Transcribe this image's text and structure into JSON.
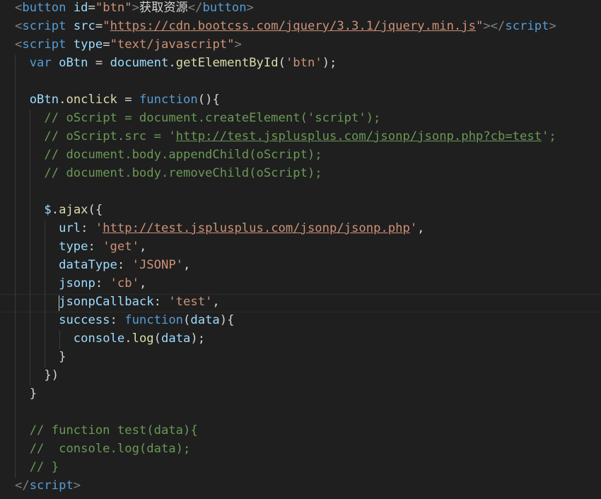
{
  "editor": {
    "language": "html",
    "theme_colors": {
      "background": "#1f1f1f",
      "tag": "#569cd6",
      "attribute": "#9cdcfe",
      "string": "#ce9178",
      "comment": "#6a9955",
      "function": "#dcdcaa",
      "text": "#d4d4d4"
    },
    "cursor_line": 17,
    "lines": [
      [
        [
          "tag-punc",
          "<"
        ],
        [
          "tag",
          "button"
        ],
        [
          "text",
          " "
        ],
        [
          "attr",
          "id"
        ],
        [
          "punc",
          "="
        ],
        [
          "str",
          "\"btn\""
        ],
        [
          "tag-punc",
          ">"
        ],
        [
          "text",
          "获取资源"
        ],
        [
          "tag-punc",
          "</"
        ],
        [
          "tag",
          "button"
        ],
        [
          "tag-punc",
          ">"
        ]
      ],
      [
        [
          "tag-punc",
          "<"
        ],
        [
          "tag",
          "script"
        ],
        [
          "text",
          " "
        ],
        [
          "attr",
          "src"
        ],
        [
          "punc",
          "="
        ],
        [
          "str",
          "\""
        ],
        [
          "url",
          "https://cdn.bootcss.com/jquery/3.3.1/jquery.min.js"
        ],
        [
          "str",
          "\""
        ],
        [
          "tag-punc",
          "></"
        ],
        [
          "tag",
          "script"
        ],
        [
          "tag-punc",
          ">"
        ]
      ],
      [
        [
          "tag-punc",
          "<"
        ],
        [
          "tag",
          "script"
        ],
        [
          "text",
          " "
        ],
        [
          "attr",
          "type"
        ],
        [
          "punc",
          "="
        ],
        [
          "str",
          "\"text/javascript\""
        ],
        [
          "tag-punc",
          ">"
        ]
      ],
      [
        [
          "text",
          "  "
        ],
        [
          "kw",
          "var"
        ],
        [
          "text",
          " "
        ],
        [
          "var",
          "oBtn"
        ],
        [
          "punc",
          " = "
        ],
        [
          "var",
          "document"
        ],
        [
          "punc",
          "."
        ],
        [
          "fn",
          "getElementById"
        ],
        [
          "punc",
          "("
        ],
        [
          "str",
          "'btn'"
        ],
        [
          "punc",
          ");"
        ]
      ],
      [],
      [
        [
          "text",
          "  "
        ],
        [
          "var",
          "oBtn"
        ],
        [
          "punc",
          "."
        ],
        [
          "fn",
          "onclick"
        ],
        [
          "punc",
          " = "
        ],
        [
          "kw",
          "function"
        ],
        [
          "punc",
          "(){"
        ]
      ],
      [
        [
          "text",
          "    "
        ],
        [
          "cm",
          "// oScript = document.createElement('script');"
        ]
      ],
      [
        [
          "text",
          "    "
        ],
        [
          "cm",
          "// oScript.src = '"
        ],
        [
          "cm-url",
          "http://test.jsplusplus.com/jsonp/jsonp.php?cb=test"
        ],
        [
          "cm",
          "';"
        ]
      ],
      [
        [
          "text",
          "    "
        ],
        [
          "cm",
          "// document.body.appendChild(oScript);"
        ]
      ],
      [
        [
          "text",
          "    "
        ],
        [
          "cm",
          "// document.body.removeChild(oScript);"
        ]
      ],
      [],
      [
        [
          "text",
          "    "
        ],
        [
          "var",
          "$"
        ],
        [
          "punc",
          "."
        ],
        [
          "fn",
          "ajax"
        ],
        [
          "punc",
          "({"
        ]
      ],
      [
        [
          "text",
          "      "
        ],
        [
          "var",
          "url"
        ],
        [
          "punc",
          ": "
        ],
        [
          "str",
          "'"
        ],
        [
          "url",
          "http://test.jsplusplus.com/jsonp/jsonp.php"
        ],
        [
          "str",
          "'"
        ],
        [
          "punc",
          ","
        ]
      ],
      [
        [
          "text",
          "      "
        ],
        [
          "var",
          "type"
        ],
        [
          "punc",
          ": "
        ],
        [
          "str",
          "'get'"
        ],
        [
          "punc",
          ","
        ]
      ],
      [
        [
          "text",
          "      "
        ],
        [
          "var",
          "dataType"
        ],
        [
          "punc",
          ": "
        ],
        [
          "str",
          "'JSONP'"
        ],
        [
          "punc",
          ","
        ]
      ],
      [
        [
          "text",
          "      "
        ],
        [
          "var",
          "jsonp"
        ],
        [
          "punc",
          ": "
        ],
        [
          "str",
          "'cb'"
        ],
        [
          "punc",
          ","
        ]
      ],
      [
        [
          "text",
          "      "
        ],
        [
          "var",
          "jsonpCallback"
        ],
        [
          "punc",
          ": "
        ],
        [
          "str",
          "'test'"
        ],
        [
          "punc",
          ","
        ]
      ],
      [
        [
          "text",
          "      "
        ],
        [
          "var",
          "success"
        ],
        [
          "punc",
          ": "
        ],
        [
          "kw",
          "function"
        ],
        [
          "punc",
          "("
        ],
        [
          "var",
          "data"
        ],
        [
          "punc",
          "){"
        ]
      ],
      [
        [
          "text",
          "        "
        ],
        [
          "var",
          "console"
        ],
        [
          "punc",
          "."
        ],
        [
          "fn",
          "log"
        ],
        [
          "punc",
          "("
        ],
        [
          "var",
          "data"
        ],
        [
          "punc",
          ");"
        ]
      ],
      [
        [
          "text",
          "      "
        ],
        [
          "punc",
          "}"
        ]
      ],
      [
        [
          "text",
          "    "
        ],
        [
          "punc",
          "})"
        ]
      ],
      [
        [
          "text",
          "  "
        ],
        [
          "punc",
          "}"
        ]
      ],
      [],
      [
        [
          "text",
          "  "
        ],
        [
          "cm",
          "// function test(data){"
        ]
      ],
      [
        [
          "text",
          "  "
        ],
        [
          "cm",
          "//  console.log(data);"
        ]
      ],
      [
        [
          "text",
          "  "
        ],
        [
          "cm",
          "// }"
        ]
      ],
      [
        [
          "tag-punc",
          "</"
        ],
        [
          "tag",
          "script"
        ],
        [
          "tag-punc",
          ">"
        ]
      ]
    ]
  }
}
